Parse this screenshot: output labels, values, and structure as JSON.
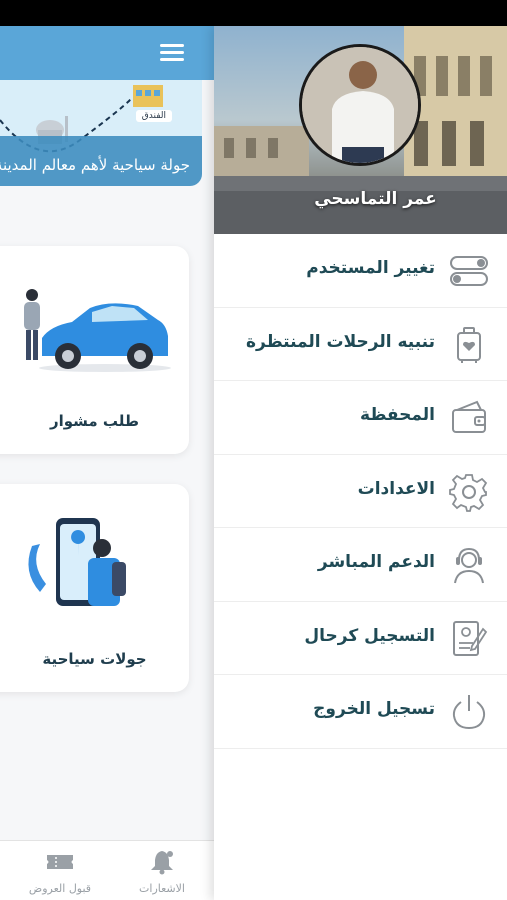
{
  "background_app": {
    "banner": {
      "title": "جولة سياحية لأهم معالم المدينة",
      "hotel_tag": "الفندق"
    },
    "services": [
      {
        "label": "طلب مشوار"
      },
      {
        "label": "جولات سياحية"
      }
    ],
    "bottom_nav": {
      "notifications_label": "الاشعارات",
      "offers_label": "قبول العروض"
    }
  },
  "drawer": {
    "user_name": "عمر التماسحي",
    "menu": [
      {
        "label": "تغيير المستخدم",
        "icon": "toggle-icon"
      },
      {
        "label": "تنبيه الرحلات المنتظرة",
        "icon": "luggage-icon"
      },
      {
        "label": "المحفظة",
        "icon": "wallet-icon"
      },
      {
        "label": "الاعدادات",
        "icon": "gear-icon"
      },
      {
        "label": "الدعم المباشر",
        "icon": "headset-icon"
      },
      {
        "label": "التسجيل كرحال",
        "icon": "document-icon"
      },
      {
        "label": "تسجيل الخروج",
        "icon": "power-icon"
      }
    ]
  },
  "colors": {
    "header_blue": "#5aa6d8",
    "menu_text": "#1f4a55",
    "icon_gray": "#8a8f94"
  }
}
